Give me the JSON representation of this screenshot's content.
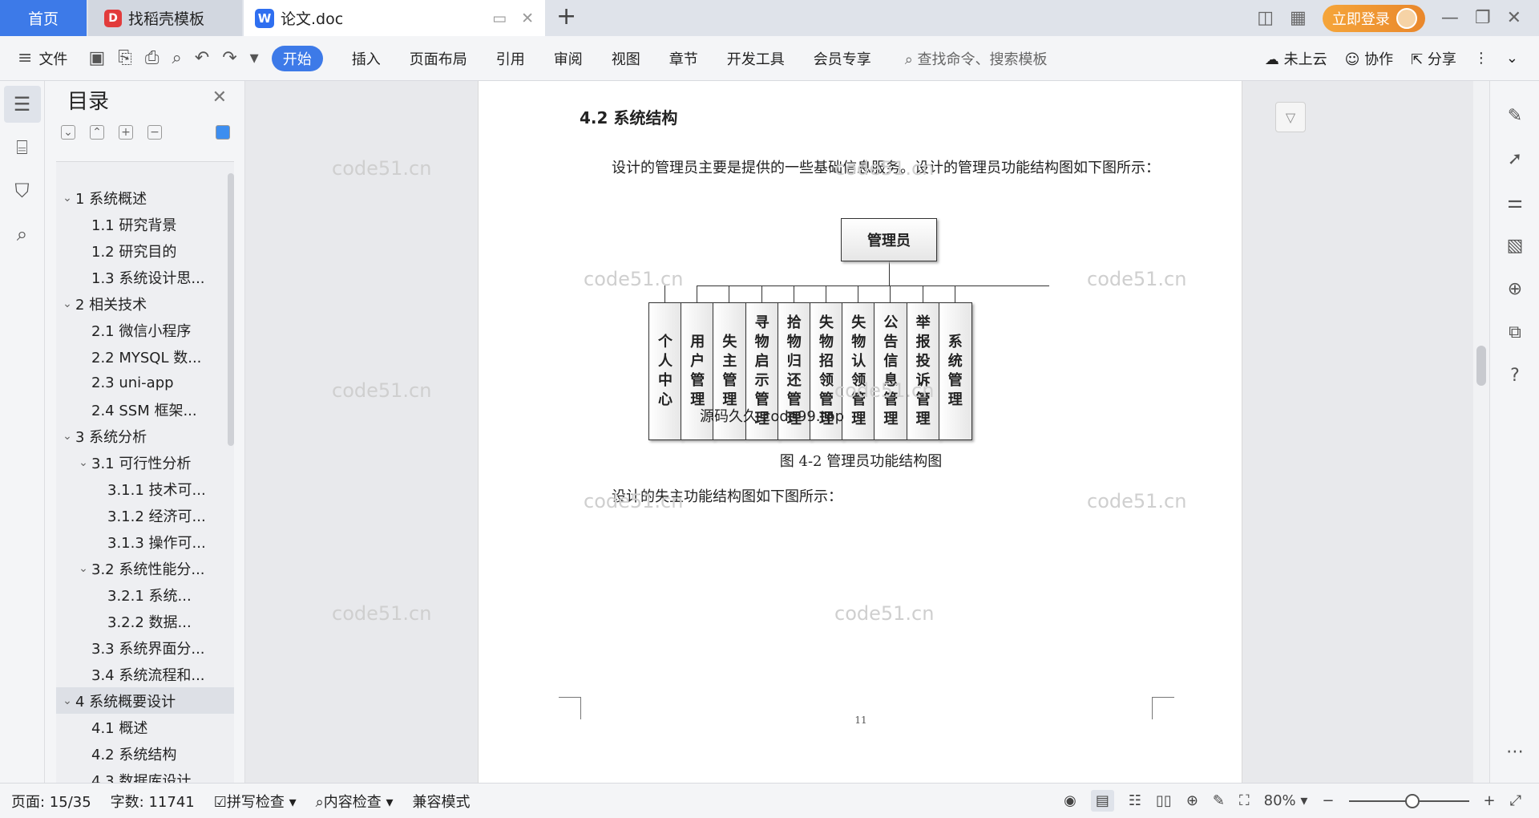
{
  "tabs": {
    "home": "首页",
    "template": "找稻壳模板",
    "doc": "论文.doc",
    "login": "立即登录"
  },
  "ribbon": {
    "file": "文件",
    "start": "开始",
    "insert": "插入",
    "layout": "页面布局",
    "refs": "引用",
    "review": "审阅",
    "view": "视图",
    "chapter": "章节",
    "dev": "开发工具",
    "member": "会员专享",
    "search": "查找命令、搜索模板",
    "cloud": "未上云",
    "collab": "协作",
    "share": "分享"
  },
  "toc": {
    "title": "目录",
    "items": [
      {
        "label": "1 系统概述",
        "level": 1,
        "expanded": true
      },
      {
        "label": "1.1  研究背景",
        "level": 2
      },
      {
        "label": "1.2 研究目的",
        "level": 2
      },
      {
        "label": "1.3 系统设计思...",
        "level": 2
      },
      {
        "label": "2 相关技术",
        "level": 1,
        "expanded": true
      },
      {
        "label": "2.1 微信小程序",
        "level": 2
      },
      {
        "label": "2.2 MYSQL 数...",
        "level": 2
      },
      {
        "label": "2.3 uni-app",
        "level": 2
      },
      {
        "label": "2.4 SSM 框架...",
        "level": 2
      },
      {
        "label": "3 系统分析",
        "level": 1,
        "expanded": true
      },
      {
        "label": "3.1 可行性分析",
        "level": 2,
        "expanded": true
      },
      {
        "label": "3.1.1 技术可...",
        "level": 3
      },
      {
        "label": "3.1.2 经济可...",
        "level": 3
      },
      {
        "label": "3.1.3 操作可...",
        "level": 3
      },
      {
        "label": "3.2 系统性能分...",
        "level": 2,
        "expanded": true
      },
      {
        "label": "3.2.1  系统...",
        "level": 3
      },
      {
        "label": "3.2.2  数据...",
        "level": 3
      },
      {
        "label": "3.3 系统界面分...",
        "level": 2
      },
      {
        "label": "3.4 系统流程和...",
        "level": 2
      },
      {
        "label": "4 系统概要设计",
        "level": 1,
        "expanded": true,
        "selected": true
      },
      {
        "label": "4.1 概述",
        "level": 2
      },
      {
        "label": "4.2 系统结构",
        "level": 2
      },
      {
        "label": "4.3 数据库设计",
        "level": 2
      }
    ]
  },
  "doc": {
    "heading": "4.2 系统结构",
    "para1": "设计的管理员主要是提供的一些基础信息服务。设计的管理员功能结构图如下图所示：",
    "root": "管理员",
    "children": [
      "个人中心",
      "用户管理",
      "失主管理",
      "寻物启示管理",
      "拾物归还管理",
      "失物招领管理",
      "失物认领管理",
      "公告信息管理",
      "举报投诉管理",
      "系统管理"
    ],
    "overlay": "源码久久-code99.top",
    "caption": "图 4-2 管理员功能结构图",
    "para2": "设计的失主功能结构图如下图所示：",
    "page_number": "11",
    "watermark": "code51.cn"
  },
  "status": {
    "page": "页面: 15/35",
    "words": "字数: 11741",
    "spell": "拼写检查",
    "content": "内容检查",
    "compat": "兼容模式",
    "zoom": "80%"
  }
}
